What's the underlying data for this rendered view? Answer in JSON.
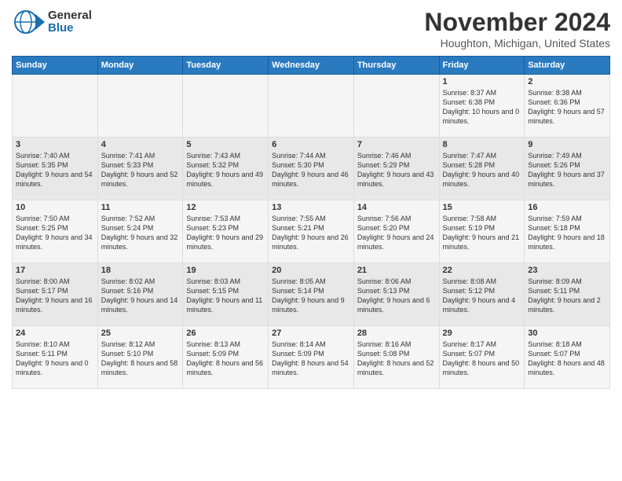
{
  "header": {
    "logo_general": "General",
    "logo_blue": "Blue",
    "month": "November 2024",
    "location": "Houghton, Michigan, United States"
  },
  "days_of_week": [
    "Sunday",
    "Monday",
    "Tuesday",
    "Wednesday",
    "Thursday",
    "Friday",
    "Saturday"
  ],
  "weeks": [
    [
      {
        "day": "",
        "sunrise": "",
        "sunset": "",
        "daylight": ""
      },
      {
        "day": "",
        "sunrise": "",
        "sunset": "",
        "daylight": ""
      },
      {
        "day": "",
        "sunrise": "",
        "sunset": "",
        "daylight": ""
      },
      {
        "day": "",
        "sunrise": "",
        "sunset": "",
        "daylight": ""
      },
      {
        "day": "",
        "sunrise": "",
        "sunset": "",
        "daylight": ""
      },
      {
        "day": "1",
        "sunrise": "Sunrise: 8:37 AM",
        "sunset": "Sunset: 6:38 PM",
        "daylight": "Daylight: 10 hours and 0 minutes."
      },
      {
        "day": "2",
        "sunrise": "Sunrise: 8:38 AM",
        "sunset": "Sunset: 6:36 PM",
        "daylight": "Daylight: 9 hours and 57 minutes."
      }
    ],
    [
      {
        "day": "3",
        "sunrise": "Sunrise: 7:40 AM",
        "sunset": "Sunset: 5:35 PM",
        "daylight": "Daylight: 9 hours and 54 minutes."
      },
      {
        "day": "4",
        "sunrise": "Sunrise: 7:41 AM",
        "sunset": "Sunset: 5:33 PM",
        "daylight": "Daylight: 9 hours and 52 minutes."
      },
      {
        "day": "5",
        "sunrise": "Sunrise: 7:43 AM",
        "sunset": "Sunset: 5:32 PM",
        "daylight": "Daylight: 9 hours and 49 minutes."
      },
      {
        "day": "6",
        "sunrise": "Sunrise: 7:44 AM",
        "sunset": "Sunset: 5:30 PM",
        "daylight": "Daylight: 9 hours and 46 minutes."
      },
      {
        "day": "7",
        "sunrise": "Sunrise: 7:46 AM",
        "sunset": "Sunset: 5:29 PM",
        "daylight": "Daylight: 9 hours and 43 minutes."
      },
      {
        "day": "8",
        "sunrise": "Sunrise: 7:47 AM",
        "sunset": "Sunset: 5:28 PM",
        "daylight": "Daylight: 9 hours and 40 minutes."
      },
      {
        "day": "9",
        "sunrise": "Sunrise: 7:49 AM",
        "sunset": "Sunset: 5:26 PM",
        "daylight": "Daylight: 9 hours and 37 minutes."
      }
    ],
    [
      {
        "day": "10",
        "sunrise": "Sunrise: 7:50 AM",
        "sunset": "Sunset: 5:25 PM",
        "daylight": "Daylight: 9 hours and 34 minutes."
      },
      {
        "day": "11",
        "sunrise": "Sunrise: 7:52 AM",
        "sunset": "Sunset: 5:24 PM",
        "daylight": "Daylight: 9 hours and 32 minutes."
      },
      {
        "day": "12",
        "sunrise": "Sunrise: 7:53 AM",
        "sunset": "Sunset: 5:23 PM",
        "daylight": "Daylight: 9 hours and 29 minutes."
      },
      {
        "day": "13",
        "sunrise": "Sunrise: 7:55 AM",
        "sunset": "Sunset: 5:21 PM",
        "daylight": "Daylight: 9 hours and 26 minutes."
      },
      {
        "day": "14",
        "sunrise": "Sunrise: 7:56 AM",
        "sunset": "Sunset: 5:20 PM",
        "daylight": "Daylight: 9 hours and 24 minutes."
      },
      {
        "day": "15",
        "sunrise": "Sunrise: 7:58 AM",
        "sunset": "Sunset: 5:19 PM",
        "daylight": "Daylight: 9 hours and 21 minutes."
      },
      {
        "day": "16",
        "sunrise": "Sunrise: 7:59 AM",
        "sunset": "Sunset: 5:18 PM",
        "daylight": "Daylight: 9 hours and 18 minutes."
      }
    ],
    [
      {
        "day": "17",
        "sunrise": "Sunrise: 8:00 AM",
        "sunset": "Sunset: 5:17 PM",
        "daylight": "Daylight: 9 hours and 16 minutes."
      },
      {
        "day": "18",
        "sunrise": "Sunrise: 8:02 AM",
        "sunset": "Sunset: 5:16 PM",
        "daylight": "Daylight: 9 hours and 14 minutes."
      },
      {
        "day": "19",
        "sunrise": "Sunrise: 8:03 AM",
        "sunset": "Sunset: 5:15 PM",
        "daylight": "Daylight: 9 hours and 11 minutes."
      },
      {
        "day": "20",
        "sunrise": "Sunrise: 8:05 AM",
        "sunset": "Sunset: 5:14 PM",
        "daylight": "Daylight: 9 hours and 9 minutes."
      },
      {
        "day": "21",
        "sunrise": "Sunrise: 8:06 AM",
        "sunset": "Sunset: 5:13 PM",
        "daylight": "Daylight: 9 hours and 6 minutes."
      },
      {
        "day": "22",
        "sunrise": "Sunrise: 8:08 AM",
        "sunset": "Sunset: 5:12 PM",
        "daylight": "Daylight: 9 hours and 4 minutes."
      },
      {
        "day": "23",
        "sunrise": "Sunrise: 8:09 AM",
        "sunset": "Sunset: 5:11 PM",
        "daylight": "Daylight: 9 hours and 2 minutes."
      }
    ],
    [
      {
        "day": "24",
        "sunrise": "Sunrise: 8:10 AM",
        "sunset": "Sunset: 5:11 PM",
        "daylight": "Daylight: 9 hours and 0 minutes."
      },
      {
        "day": "25",
        "sunrise": "Sunrise: 8:12 AM",
        "sunset": "Sunset: 5:10 PM",
        "daylight": "Daylight: 8 hours and 58 minutes."
      },
      {
        "day": "26",
        "sunrise": "Sunrise: 8:13 AM",
        "sunset": "Sunset: 5:09 PM",
        "daylight": "Daylight: 8 hours and 56 minutes."
      },
      {
        "day": "27",
        "sunrise": "Sunrise: 8:14 AM",
        "sunset": "Sunset: 5:09 PM",
        "daylight": "Daylight: 8 hours and 54 minutes."
      },
      {
        "day": "28",
        "sunrise": "Sunrise: 8:16 AM",
        "sunset": "Sunset: 5:08 PM",
        "daylight": "Daylight: 8 hours and 52 minutes."
      },
      {
        "day": "29",
        "sunrise": "Sunrise: 8:17 AM",
        "sunset": "Sunset: 5:07 PM",
        "daylight": "Daylight: 8 hours and 50 minutes."
      },
      {
        "day": "30",
        "sunrise": "Sunrise: 8:18 AM",
        "sunset": "Sunset: 5:07 PM",
        "daylight": "Daylight: 8 hours and 48 minutes."
      }
    ]
  ]
}
